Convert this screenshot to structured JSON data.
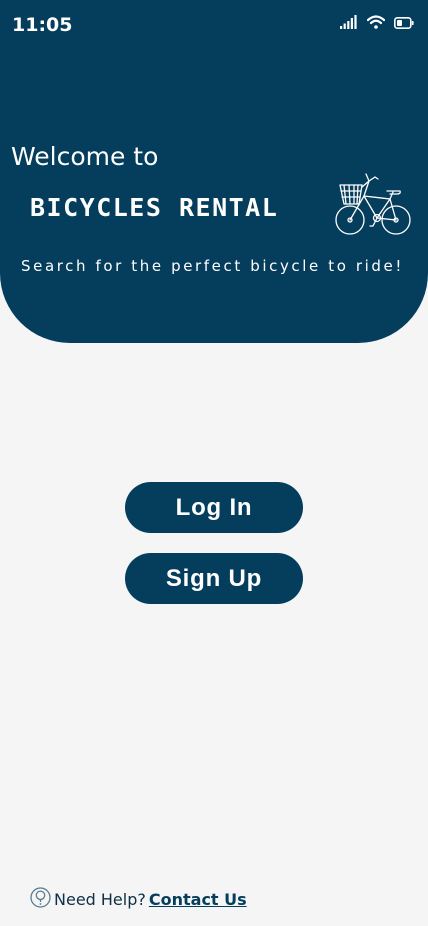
{
  "status_bar": {
    "time": "11:05",
    "icons": [
      "cellular-signal-icon",
      "wifi-icon",
      "battery-icon"
    ]
  },
  "header": {
    "welcome": "Welcome to",
    "brand": "BICYCLES RENTAL",
    "tagline": "Search for the perfect bicycle to ride!",
    "illustration": "bicycle-icon"
  },
  "actions": {
    "login_label": "Log In",
    "signup_label": "Sign Up"
  },
  "footer": {
    "help_icon": "question-icon",
    "help_text": "Need Help?",
    "contact_label": "Contact Us"
  },
  "colors": {
    "primary": "#053d5c",
    "background": "#f5f5f5",
    "text_on_primary": "#ffffff"
  }
}
